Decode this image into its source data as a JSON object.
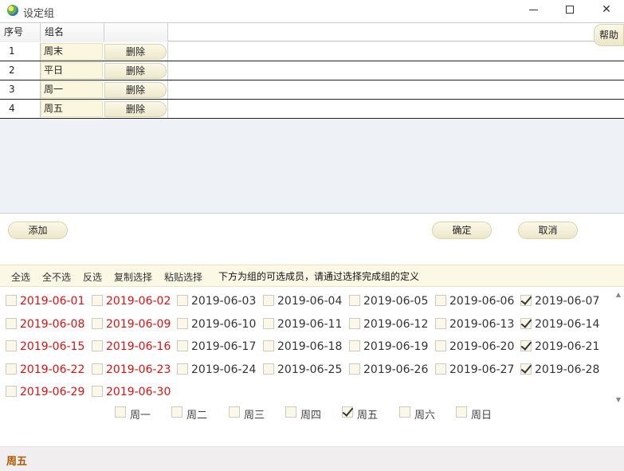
{
  "window": {
    "title": "设定组",
    "minimize": "—",
    "maximize": "☐",
    "close": "✕"
  },
  "help_label": "帮助",
  "grid": {
    "headers": [
      "序号",
      "组名",
      ""
    ],
    "rows": [
      {
        "index": "1",
        "name": "周末",
        "action": "删除"
      },
      {
        "index": "2",
        "name": "平日",
        "action": "删除"
      },
      {
        "index": "3",
        "name": "周一",
        "action": "删除"
      },
      {
        "index": "4",
        "name": "周五",
        "action": "删除"
      }
    ]
  },
  "buttons": {
    "add": "添加",
    "ok": "确定",
    "cancel": "取消"
  },
  "toolbar": {
    "items": [
      "全选",
      "全不选",
      "反选",
      "复制选择",
      "粘贴选择"
    ],
    "hint": "下方为组的可选成员，请通过选择完成组的定义"
  },
  "dates": [
    {
      "label": "2019-06-01",
      "red": true,
      "checked": false
    },
    {
      "label": "2019-06-02",
      "red": true,
      "checked": false
    },
    {
      "label": "2019-06-03",
      "red": false,
      "checked": false
    },
    {
      "label": "2019-06-04",
      "red": false,
      "checked": false
    },
    {
      "label": "2019-06-05",
      "red": false,
      "checked": false
    },
    {
      "label": "2019-06-06",
      "red": false,
      "checked": false
    },
    {
      "label": "2019-06-07",
      "red": false,
      "checked": true
    },
    {
      "label": "2019-06-08",
      "red": true,
      "checked": false
    },
    {
      "label": "2019-06-09",
      "red": true,
      "checked": false
    },
    {
      "label": "2019-06-10",
      "red": false,
      "checked": false
    },
    {
      "label": "2019-06-11",
      "red": false,
      "checked": false
    },
    {
      "label": "2019-06-12",
      "red": false,
      "checked": false
    },
    {
      "label": "2019-06-13",
      "red": false,
      "checked": false
    },
    {
      "label": "2019-06-14",
      "red": false,
      "checked": true
    },
    {
      "label": "2019-06-15",
      "red": true,
      "checked": false
    },
    {
      "label": "2019-06-16",
      "red": true,
      "checked": false
    },
    {
      "label": "2019-06-17",
      "red": false,
      "checked": false
    },
    {
      "label": "2019-06-18",
      "red": false,
      "checked": false
    },
    {
      "label": "2019-06-19",
      "red": false,
      "checked": false
    },
    {
      "label": "2019-06-20",
      "red": false,
      "checked": false
    },
    {
      "label": "2019-06-21",
      "red": false,
      "checked": true
    },
    {
      "label": "2019-06-22",
      "red": true,
      "checked": false
    },
    {
      "label": "2019-06-23",
      "red": true,
      "checked": false
    },
    {
      "label": "2019-06-24",
      "red": false,
      "checked": false
    },
    {
      "label": "2019-06-25",
      "red": false,
      "checked": false
    },
    {
      "label": "2019-06-26",
      "red": false,
      "checked": false
    },
    {
      "label": "2019-06-27",
      "red": false,
      "checked": false
    },
    {
      "label": "2019-06-28",
      "red": false,
      "checked": true
    },
    {
      "label": "2019-06-29",
      "red": true,
      "checked": false
    },
    {
      "label": "2019-06-30",
      "red": true,
      "checked": false
    }
  ],
  "weekdays": [
    {
      "label": "周一",
      "checked": false
    },
    {
      "label": "周二",
      "checked": false
    },
    {
      "label": "周三",
      "checked": false
    },
    {
      "label": "周四",
      "checked": false
    },
    {
      "label": "周五",
      "checked": true
    },
    {
      "label": "周六",
      "checked": false
    },
    {
      "label": "周日",
      "checked": false
    }
  ],
  "status": {
    "text": "周五"
  },
  "colors": {
    "weekend": "#e01010",
    "accent_status": "#a85a00",
    "button_face": "#f4f0d8"
  }
}
